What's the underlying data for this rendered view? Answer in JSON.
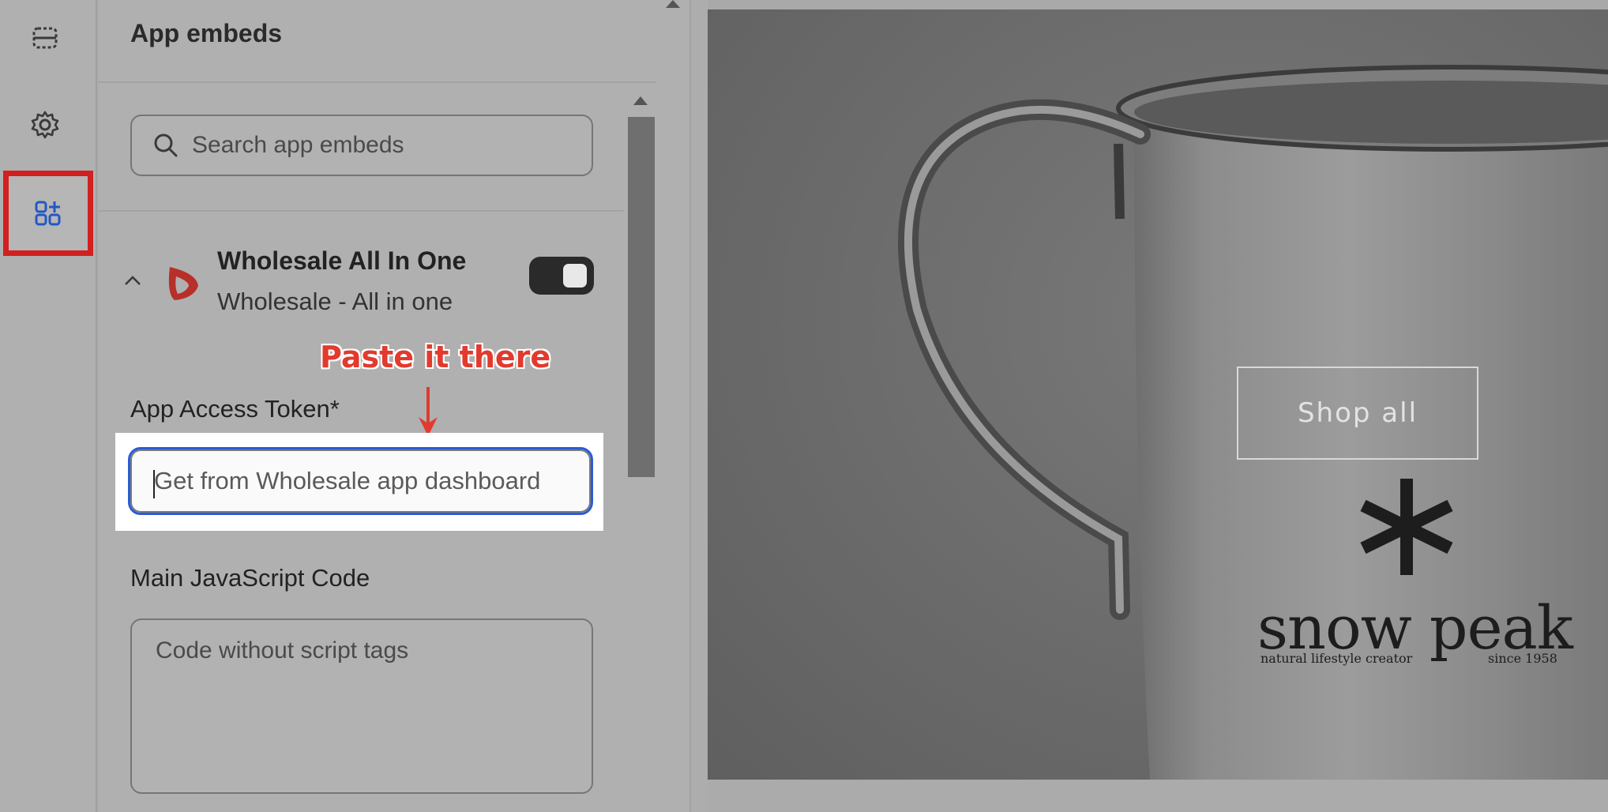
{
  "rail": {
    "items": [
      {
        "icon": "sections-icon"
      },
      {
        "icon": "gear-icon"
      },
      {
        "icon": "app-embeds-icon",
        "active": true
      }
    ]
  },
  "panel": {
    "title": "App embeds",
    "search": {
      "placeholder": "Search app embeds"
    },
    "app": {
      "name": "Wholesale All In One",
      "subtitle": "Wholesale - All in one",
      "enabled": true
    },
    "annotation": "Paste it there",
    "token_field": {
      "label": "App Access Token*",
      "placeholder": "Get from Wholesale app dashboard",
      "value": ""
    },
    "code_field": {
      "label": "Main JavaScript Code",
      "placeholder": "Code without script tags",
      "value": ""
    }
  },
  "preview": {
    "button_label": "Shop all",
    "brand_name": "snow peak",
    "brand_tagline": "natural lifestyle creator",
    "brand_since": "since 1958"
  },
  "colors": {
    "highlight_red": "#d21f1f",
    "annotation_red": "#e23a2e",
    "focus_blue": "#2a5bd7",
    "toggle_on": "#2a2a2a"
  }
}
